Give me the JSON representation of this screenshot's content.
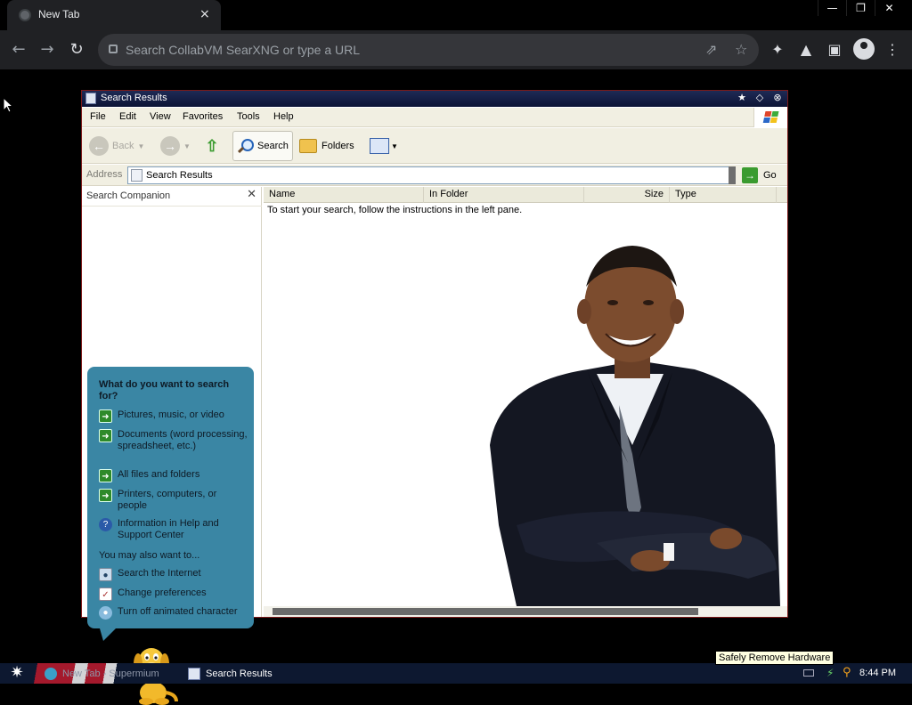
{
  "browser": {
    "tab_title": "New Tab",
    "tab_close": "×",
    "omnibox_placeholder": "Search CollabVM SearXNG or type a URL",
    "window_controls": [
      "—",
      "❐",
      "✕"
    ]
  },
  "window": {
    "title": "Search Results",
    "title_buttons": [
      "★",
      "◇",
      "⊗"
    ]
  },
  "menu": [
    "File",
    "Edit",
    "View",
    "Favorites",
    "Tools",
    "Help"
  ],
  "toolbar": {
    "back_label": "Back",
    "search_label": "Search",
    "folders_label": "Folders"
  },
  "address": {
    "label": "Address",
    "value": "Search Results",
    "go_label": "Go"
  },
  "left_pane": {
    "title": "Search Companion",
    "question": "What do you want to search for?",
    "options": [
      {
        "label": "Pictures, music, or video",
        "icon": "arrow-right-icon"
      },
      {
        "label": "Documents (word processing, spreadsheet, etc.)",
        "icon": "arrow-right-icon"
      },
      {
        "label": "All files and folders",
        "icon": "arrow-right-icon"
      },
      {
        "label": "Printers, computers, or people",
        "icon": "arrow-right-icon"
      },
      {
        "label": "Information in Help and Support Center",
        "icon": "help-icon"
      }
    ],
    "also_label": "You may also want to...",
    "also_options": [
      {
        "label": "Search the Internet",
        "icon": "search-internet-icon"
      },
      {
        "label": "Change preferences",
        "icon": "preferences-icon"
      },
      {
        "label": "Turn off animated character",
        "icon": "character-icon"
      }
    ]
  },
  "list": {
    "columns": [
      "Name",
      "In Folder",
      "Size",
      "Type"
    ],
    "hint": "To start your search, follow the instructions in the left pane."
  },
  "taskbar": {
    "tasks": [
      {
        "label": "New Tab - Supermium"
      },
      {
        "label": "Search Results"
      }
    ],
    "clock": "8:44 PM",
    "tooltip": "Safely Remove Hardware"
  },
  "colors": {
    "balloon": "#3a86a4",
    "xp_toolbar": "#f1efe2",
    "taskbar": "#0d1830"
  }
}
